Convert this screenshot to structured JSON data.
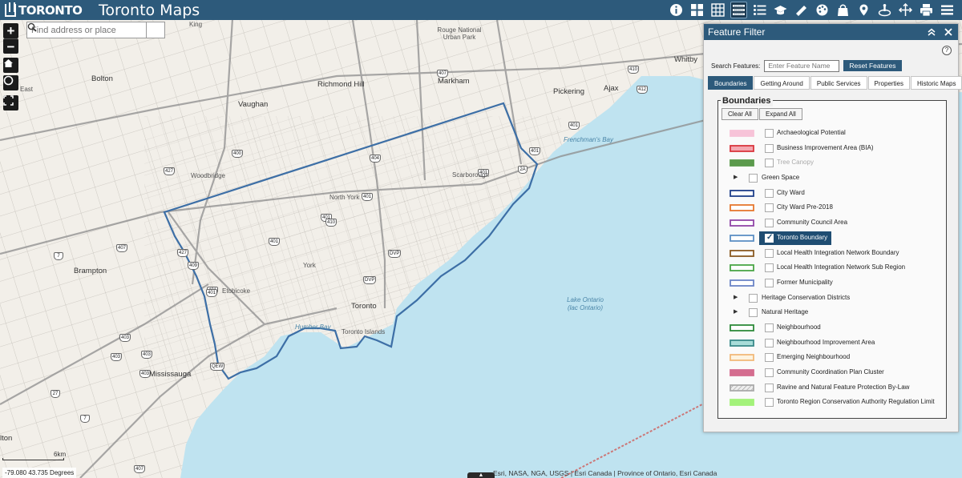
{
  "header": {
    "logo_text": "TORONTO",
    "title": "Toronto Maps",
    "tools": [
      {
        "icon": "info-icon"
      },
      {
        "icon": "basemap-grid-icon"
      },
      {
        "icon": "layers-grid-icon"
      },
      {
        "icon": "feature-filter-icon",
        "active": true
      },
      {
        "icon": "list-icon"
      },
      {
        "icon": "graduation-cap-icon"
      },
      {
        "icon": "measure-ruler-icon"
      },
      {
        "icon": "palette-icon"
      },
      {
        "icon": "bag-icon"
      },
      {
        "icon": "locate-icon"
      },
      {
        "icon": "hand-pointer-icon"
      },
      {
        "icon": "share-icon"
      },
      {
        "icon": "print-icon"
      },
      {
        "icon": "menu-icon"
      }
    ]
  },
  "map": {
    "search_placeholder": "Find address or place",
    "labels": [
      "King",
      "Rouge National Urban Park",
      "Whitby",
      "Bolton",
      "Richmond Hill",
      "Markham",
      "Vaughan",
      "Pickering",
      "Ajax",
      "Frenchman's Bay",
      "Woodbridge",
      "Scarborough",
      "North York",
      "Brampton",
      "York",
      "Etobicoke",
      "Toronto",
      "Toronto Islands",
      "Humber Bay",
      "Mississauga",
      "East",
      "lton"
    ],
    "water_label": "Lake Ontario (lac Ontario)",
    "scale_label": "6km",
    "coords": "-79.080 43.735 Degrees",
    "attribution": "Esri, NASA, NGA, USGS | Esri Canada | Province of Ontario, Esri Canada",
    "highways": [
      "400",
      "404",
      "407",
      "427",
      "401",
      "401",
      "401",
      "401",
      "2A",
      "409",
      "403",
      "403",
      "410",
      "412",
      "7",
      "7",
      "401",
      "403",
      "407",
      "27",
      "QEW",
      "DVP",
      "DVP",
      "401",
      "427",
      "401",
      "410",
      "401",
      "403",
      "407"
    ]
  },
  "panel": {
    "title": "Feature Filter",
    "search_label": "Search Features:",
    "search_placeholder": "Enter Feature Name",
    "reset_label": "Reset Features",
    "tabs": [
      {
        "label": "Boundaries",
        "active": true
      },
      {
        "label": "Getting Around",
        "active": false
      },
      {
        "label": "Public Services",
        "active": false
      },
      {
        "label": "Properties",
        "active": false
      },
      {
        "label": "Historic Maps",
        "active": false
      }
    ],
    "section_title": "Boundaries",
    "clear_all": "Clear All",
    "expand_all": "Expand All",
    "layers": [
      {
        "label": "Archaeological Potential",
        "swatch_fill": "#f7c3d8",
        "swatch_stroke": "#f7c3d8",
        "checked": false
      },
      {
        "label": "Business Improvement Area (BIA)",
        "swatch_fill": "#f4a7b0",
        "swatch_stroke": "#d9363e",
        "checked": false
      },
      {
        "label": "Tree Canopy",
        "swatch_fill": "#5b9a4c",
        "swatch_stroke": "#5b9a4c",
        "checked": false,
        "dim": true
      },
      {
        "label": "Green Space",
        "group": true
      },
      {
        "label": "City Ward",
        "swatch_fill": "#ffffff",
        "swatch_stroke": "#1f3f8a",
        "checked": false
      },
      {
        "label": "City Ward Pre-2018",
        "swatch_fill": "#ffffff",
        "swatch_stroke": "#e6772e",
        "checked": false
      },
      {
        "label": "Community Council Area",
        "swatch_fill": "#ffffff",
        "swatch_stroke": "#9146a8",
        "checked": false
      },
      {
        "label": "Toronto Boundary",
        "swatch_fill": "#ffffff",
        "swatch_stroke": "#5d8fc4",
        "checked": true
      },
      {
        "label": "Local Health Integration Network Boundary",
        "swatch_fill": "#ffffff",
        "swatch_stroke": "#8a5a22",
        "checked": false
      },
      {
        "label": "Local Health Integration Network Sub Region",
        "swatch_fill": "#ffffff",
        "swatch_stroke": "#4aa646",
        "checked": false
      },
      {
        "label": "Former Municipality",
        "swatch_fill": "#ffffff",
        "swatch_stroke": "#6b84c6",
        "checked": false
      },
      {
        "label": "Heritage Conservation Districts",
        "group": true
      },
      {
        "label": "Natural Heritage",
        "group": true
      },
      {
        "label": "Neighbourhood",
        "swatch_fill": "#ffffff",
        "swatch_stroke": "#2d8a3a",
        "checked": false
      },
      {
        "label": "Neighbourhood Improvement Area",
        "swatch_fill": "#a8dcd8",
        "swatch_stroke": "#3a8a8a",
        "checked": false
      },
      {
        "label": "Emerging Neighbourhood",
        "swatch_fill": "#fdf3e0",
        "swatch_stroke": "#f2b97a",
        "checked": false
      },
      {
        "label": "Community Coordination Plan Cluster",
        "swatch_fill": "#d46d8f",
        "swatch_stroke": "#d46d8f",
        "checked": false
      },
      {
        "label": "Ravine and Natural Feature Protection By-Law",
        "swatch_fill": "hatch",
        "swatch_stroke": "#aaaaaa",
        "checked": false
      },
      {
        "label": "Toronto Region Conservation Authority Regulation Limit",
        "swatch_fill": "#a3f27a",
        "swatch_stroke": "#a3f27a",
        "checked": false
      }
    ]
  }
}
